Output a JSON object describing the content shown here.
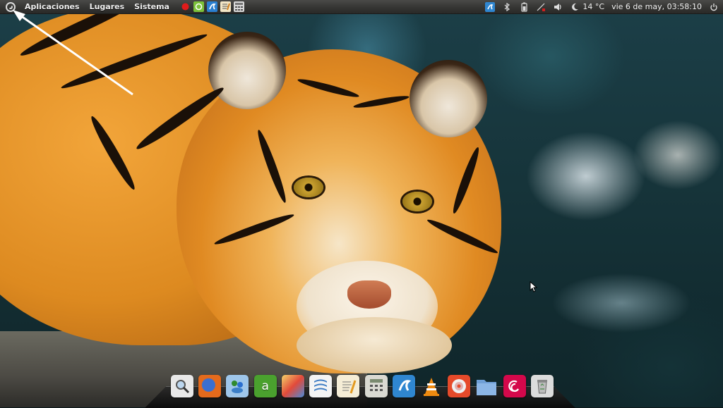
{
  "top_panel": {
    "menus": [
      "Aplicaciones",
      "Lugares",
      "Sistema"
    ],
    "launchers": [
      {
        "name": "record-icon",
        "color": "#e01b1b"
      },
      {
        "name": "game-icon",
        "color": "#7cc13a"
      },
      {
        "name": "app-icon",
        "color": "#2a7fd0"
      },
      {
        "name": "text-editor-icon",
        "color": "#f3e6c6"
      },
      {
        "name": "calculator-icon",
        "color": "#d8d8d8"
      }
    ],
    "tray": {
      "weather": "14 °C",
      "clock": "vie  6 de may, 03:58:10"
    }
  },
  "dock": {
    "items": [
      {
        "name": "search-icon",
        "color": "#e8e8e8"
      },
      {
        "name": "firefox-icon",
        "color": "#e46a1c"
      },
      {
        "name": "messenger-icon",
        "color": "#9ec6ea"
      },
      {
        "name": "amsn-icon",
        "color": "#4aa12e"
      },
      {
        "name": "paint-icon",
        "color": "#f0a040"
      },
      {
        "name": "writer-icon",
        "color": "#3f7dc4"
      },
      {
        "name": "text-editor-icon",
        "color": "#f5edd6"
      },
      {
        "name": "calculator-icon",
        "color": "#d9d9d2"
      },
      {
        "name": "ubuntu-one-icon",
        "color": "#2f86d0"
      },
      {
        "name": "vlc-icon",
        "color": "#f08a10"
      },
      {
        "name": "disc-burner-icon",
        "color": "#d23030"
      },
      {
        "name": "folder-icon",
        "color": "#6f9fd6"
      },
      {
        "name": "debian-icon",
        "color": "#d4084b"
      },
      {
        "name": "trash-icon",
        "color": "#dcdcdc"
      }
    ]
  }
}
